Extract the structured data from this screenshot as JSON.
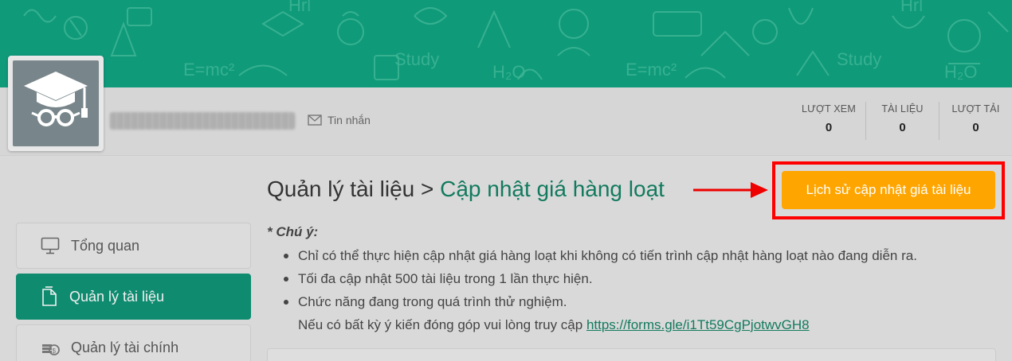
{
  "profile": {
    "message_label": "Tin nhắn",
    "stats": [
      {
        "label": "LƯỢT XEM",
        "value": "0"
      },
      {
        "label": "TÀI LIỆU",
        "value": "0"
      },
      {
        "label": "LƯỢT TẢI",
        "value": "0"
      }
    ]
  },
  "banner": {
    "doodle_text": [
      "Hrl",
      "E=mc²",
      "Study",
      "H₂O",
      "E=mc²",
      "Study",
      "H₂O",
      "Hrl"
    ]
  },
  "sidebar": {
    "items": [
      {
        "label": "Tổng quan",
        "icon": "monitor-icon",
        "active": false
      },
      {
        "label": "Quản lý tài liệu",
        "icon": "documents-icon",
        "active": true
      },
      {
        "label": "Quản lý tài chính",
        "icon": "coins-icon",
        "active": false
      }
    ]
  },
  "main": {
    "breadcrumb_parent": "Quản lý tài liệu",
    "breadcrumb_separator": " > ",
    "breadcrumb_current": "Cập nhật giá hàng loạt",
    "history_button": "Lịch sử cập nhật giá tài liệu",
    "note_title": "* Chú ý:",
    "notes": [
      "Chỉ có thể thực hiện cập nhật giá hàng loạt khi không có tiến trình cập nhật hàng loạt nào đang diễn ra.",
      "Tối đa cập nhật 500 tài liệu trong 1 lần thực hiện.",
      "Chức năng đang trong quá trình thử nghiệm."
    ],
    "feedback_text": "Nếu có bất kỳ ý kiến đóng góp vui lòng truy cập ",
    "feedback_link": "https://forms.gle/i1Tt59CgPjotwvGH8"
  },
  "colors": {
    "primary": "#0f9a7a",
    "sidebar_active": "#0f8c70",
    "link": "#127a5e",
    "button": "#ffa500",
    "highlight": "#ff0000"
  }
}
